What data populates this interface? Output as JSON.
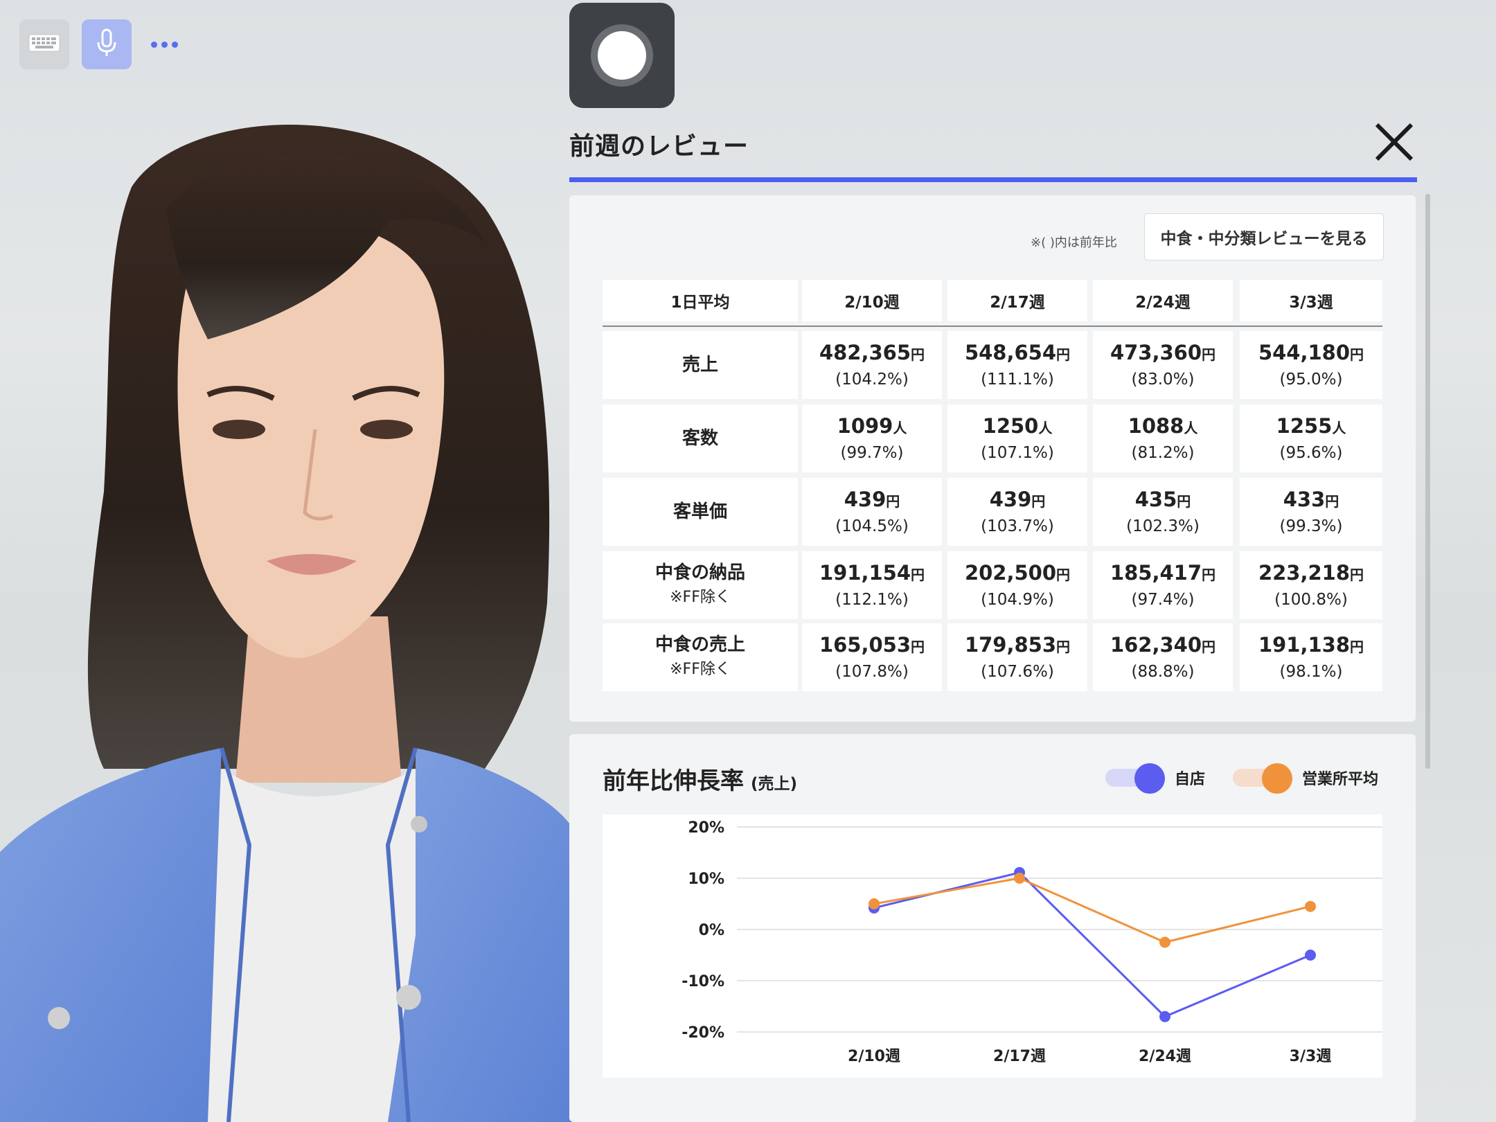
{
  "header": {
    "title": "前週のレビュー",
    "note": "※( )内は前年比",
    "sub_button": "中食・中分類レビューを見る"
  },
  "table": {
    "corner": "1日平均",
    "columns": [
      "2/10週",
      "2/17週",
      "2/24週",
      "3/3週"
    ],
    "rows": [
      {
        "label": "売上",
        "sub": "",
        "unit": "円",
        "values": [
          "482,365",
          "548,654",
          "473,360",
          "544,180"
        ],
        "pcts": [
          "(104.2%)",
          "(111.1%)",
          "(83.0%)",
          "(95.0%)"
        ]
      },
      {
        "label": "客数",
        "sub": "",
        "unit": "人",
        "values": [
          "1099",
          "1250",
          "1088",
          "1255"
        ],
        "pcts": [
          "(99.7%)",
          "(107.1%)",
          "(81.2%)",
          "(95.6%)"
        ]
      },
      {
        "label": "客単価",
        "sub": "",
        "unit": "円",
        "values": [
          "439",
          "439",
          "435",
          "433"
        ],
        "pcts": [
          "(104.5%)",
          "(103.7%)",
          "(102.3%)",
          "(99.3%)"
        ]
      },
      {
        "label": "中食の納品",
        "sub": "※FF除く",
        "unit": "円",
        "values": [
          "191,154",
          "202,500",
          "185,417",
          "223,218"
        ],
        "pcts": [
          "(112.1%)",
          "(104.9%)",
          "(97.4%)",
          "(100.8%)"
        ]
      },
      {
        "label": "中食の売上",
        "sub": "※FF除く",
        "unit": "円",
        "values": [
          "165,053",
          "179,853",
          "162,340",
          "191,138"
        ],
        "pcts": [
          "(107.8%)",
          "(107.6%)",
          "(88.8%)",
          "(98.1%)"
        ]
      }
    ]
  },
  "chart_header": {
    "title": "前年比伸長率",
    "subtitle": "(売上)"
  },
  "chart_data": {
    "type": "line",
    "title": "前年比伸長率",
    "subtitle": "(売上)",
    "categories": [
      "2/10週",
      "2/17週",
      "2/24週",
      "3/3週"
    ],
    "series": [
      {
        "name": "自店",
        "color": "#5b5cf0",
        "values": [
          4.2,
          11.1,
          -17.0,
          -5.0
        ]
      },
      {
        "name": "営業所平均",
        "color": "#f0923c",
        "values": [
          5.0,
          10.0,
          -2.5,
          4.5
        ]
      }
    ],
    "ylim": [
      -20,
      20
    ],
    "yticks": [
      20,
      10,
      0,
      -10,
      -20
    ],
    "ytick_labels": [
      "20%",
      "10%",
      "0%",
      "-10%",
      "-20%"
    ],
    "grid": true,
    "legend": "top-right"
  },
  "colors": {
    "accent": "#4a5ff0",
    "self_store": "#5b5cf0",
    "office_avg": "#f0923c"
  },
  "icons": {
    "keyboard": "keyboard-icon",
    "mic": "microphone-icon",
    "more": "more-icon",
    "record": "record-icon",
    "close": "close-icon"
  }
}
